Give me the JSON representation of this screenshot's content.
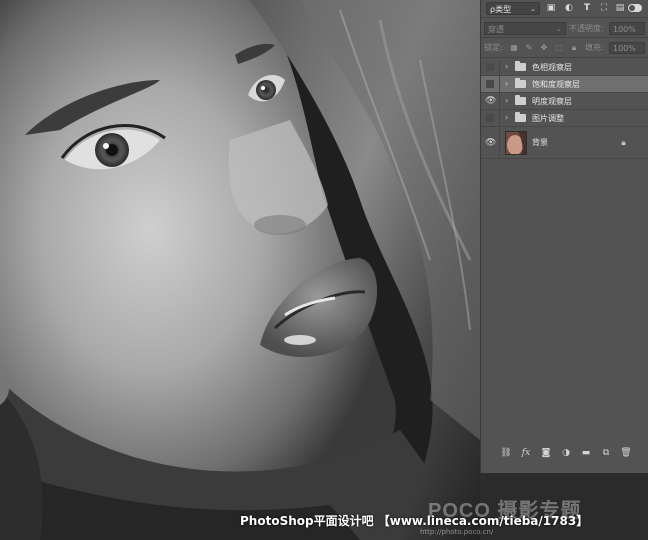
{
  "layers_panel": {
    "filter_label": "ρ类型",
    "blend_mode": "穿透",
    "opacity_label": "不透明度:",
    "opacity_value": "100%",
    "lock_label": "锁定:",
    "fill_label": "填充:",
    "fill_value": "100%",
    "layers": [
      {
        "name": "色相观察层",
        "visible": false,
        "type": "group",
        "selected": false
      },
      {
        "name": "饱和度观察层",
        "visible": false,
        "type": "group",
        "selected": true
      },
      {
        "name": "明度观察层",
        "visible": true,
        "type": "group",
        "selected": false
      },
      {
        "name": "图片调整",
        "visible": false,
        "type": "group",
        "selected": false
      },
      {
        "name": "背景",
        "visible": true,
        "type": "background",
        "locked": true
      }
    ],
    "bottom_icons": [
      "link-icon",
      "fx-icon",
      "mask-icon",
      "adjustment-icon",
      "group-folder-icon",
      "new-layer-icon",
      "trash-icon"
    ]
  },
  "watermark": {
    "text": "PhotoShop平面设计吧 【www.lineca.com/tieba/1783】",
    "poco": "POCO 摄影专题",
    "poco_sub": "http://photo.poco.cn/"
  },
  "colors": {
    "panel_bg": "#535353",
    "selected_row": "#6f6f6f",
    "text": "#e8e8e8"
  }
}
